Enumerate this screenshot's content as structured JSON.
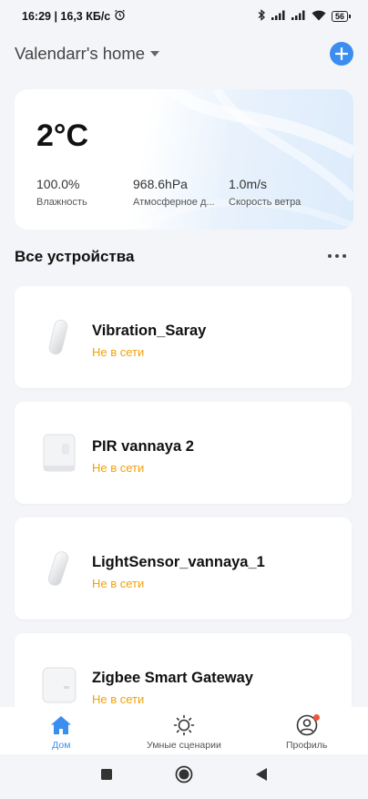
{
  "status_bar": {
    "time_and_speed": "16:29 | 16,3 КБ/с",
    "battery": "56",
    "icons": [
      "alarm-icon",
      "bluetooth-icon",
      "signal-icon",
      "signal-icon",
      "wifi-icon",
      "battery-icon"
    ]
  },
  "header": {
    "home_name": "Valendarr's home",
    "dropdown_icon": "caret-down-icon",
    "add_icon": "plus-icon"
  },
  "weather": {
    "temperature": "2°C",
    "humidity_value": "100.0%",
    "humidity_label": "Влажность",
    "pressure_value": "968.6hPa",
    "pressure_label": "Атмосферное д...",
    "wind_value": "1.0m/s",
    "wind_label": "Скорость ветра"
  },
  "section": {
    "title": "Все устройства",
    "more_icon": "more-horizontal-icon"
  },
  "devices": [
    {
      "name": "Vibration_Saray",
      "status": "Не в сети",
      "icon": "vibration-sensor-icon"
    },
    {
      "name": "PIR vannaya 2",
      "status": "Не в сети",
      "icon": "motion-sensor-icon"
    },
    {
      "name": "LightSensor_vannaya_1",
      "status": "Не в сети",
      "icon": "light-sensor-icon"
    },
    {
      "name": "Zigbee Smart Gateway",
      "status": "Не в сети",
      "icon": "gateway-icon"
    }
  ],
  "bottom_nav": [
    {
      "label": "Дом",
      "icon": "home-icon",
      "active": true
    },
    {
      "label": "Умные сценарии",
      "icon": "sun-icon",
      "active": false
    },
    {
      "label": "Профиль",
      "icon": "profile-icon",
      "active": false,
      "badge": true
    }
  ],
  "colors": {
    "accent": "#3b8ef0",
    "offline": "#f2a10a",
    "badge": "#f2533c",
    "background": "#f4f5f8"
  }
}
